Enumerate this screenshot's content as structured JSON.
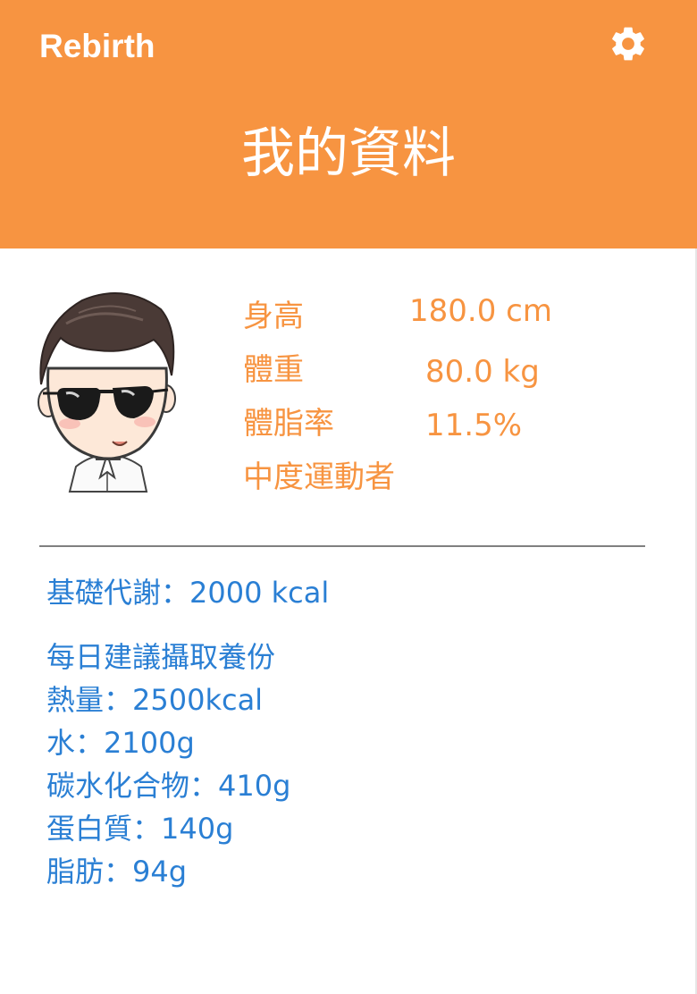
{
  "header": {
    "app_name": "Rebirth",
    "page_title": "我的資料",
    "settings_icon": "gear-icon",
    "color": "#f79441"
  },
  "profile": {
    "avatar_icon": "cartoon-avatar-sunglasses",
    "height_label": "身高",
    "height_value": "180.0 cm",
    "weight_label": "體重",
    "weight_value": "80.0 kg",
    "body_fat_label": "體脂率",
    "body_fat_value": "11.5%",
    "activity_level": "中度運動者",
    "text_color": "#f79441"
  },
  "metabolism": {
    "bmr_text": "基礎代謝：2000 kcal"
  },
  "daily_intake": {
    "title": "每日建議攝取養份",
    "calories": "熱量：2500kcal",
    "water": "水：2100g",
    "carbs": "碳水化合物：410g",
    "protein": "蛋白質：140g",
    "fat": "脂肪：94g",
    "text_color": "#2a7fd4"
  }
}
